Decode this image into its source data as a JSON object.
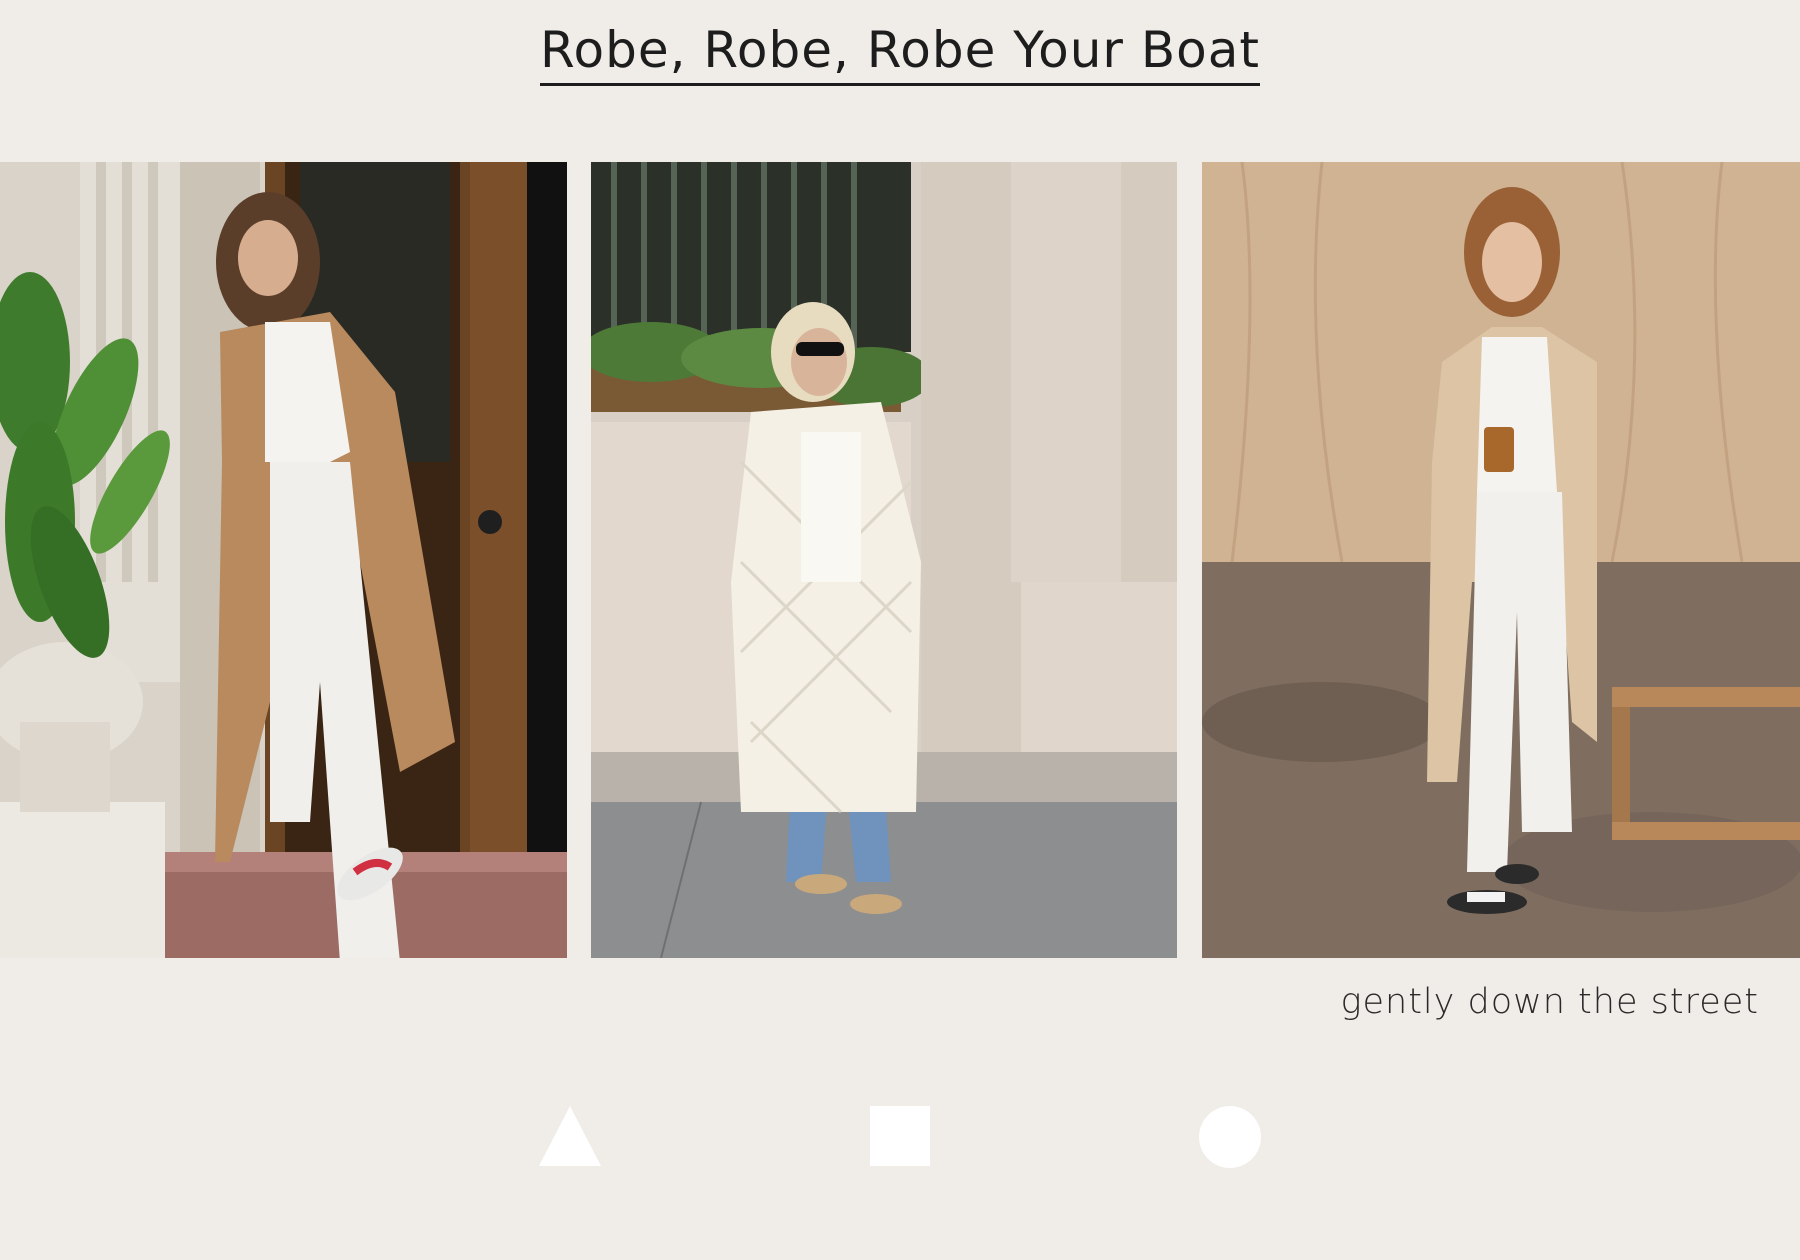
{
  "heading": {
    "title": "Robe, Robe, Robe Your Boat"
  },
  "gallery": {
    "photos": [
      {
        "icon": "photo-woman-camel-robe-doorway"
      },
      {
        "icon": "photo-woman-quilted-white-coat-street"
      },
      {
        "icon": "photo-woman-beige-robe-studio"
      }
    ]
  },
  "caption": "gently down the street",
  "navigation": {
    "shapes": [
      "triangle",
      "square",
      "circle"
    ],
    "color": "#ffffff"
  },
  "colors": {
    "background": "#f0ede9",
    "text": "#1d1d1d"
  }
}
